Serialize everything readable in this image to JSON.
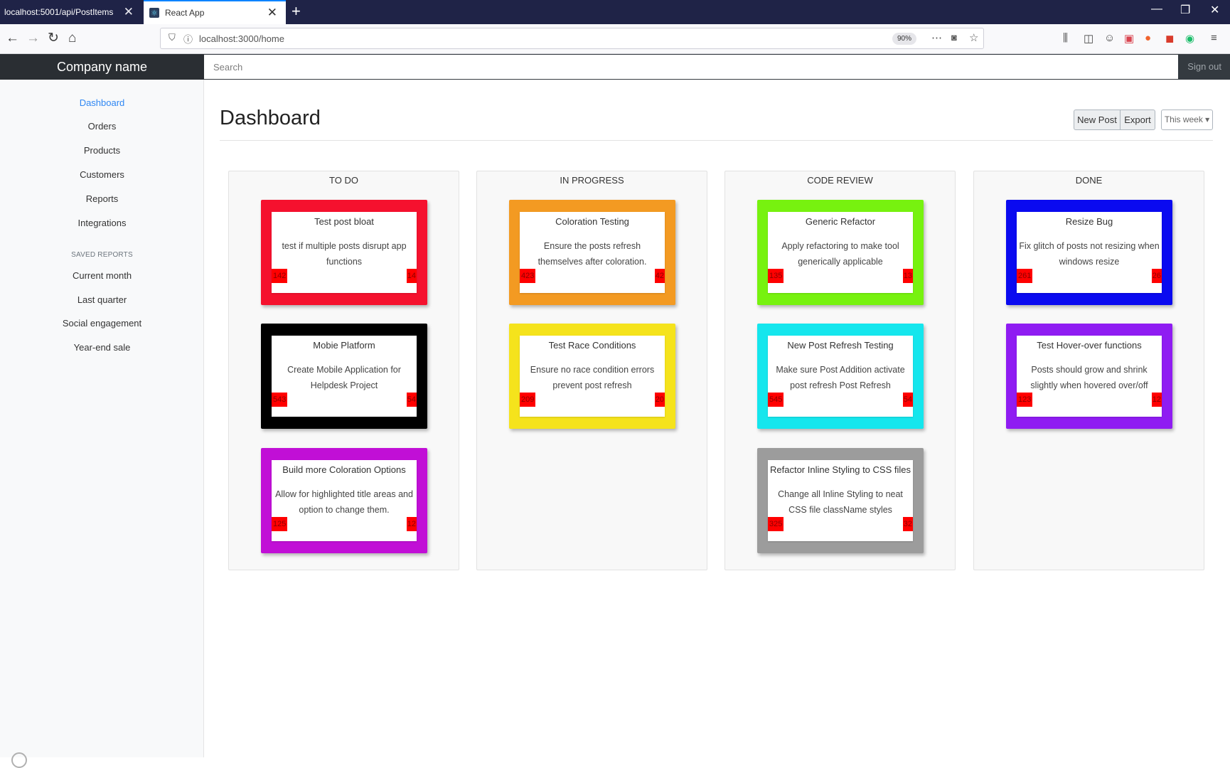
{
  "browser": {
    "tabs": [
      {
        "title": "localhost:5001/api/PostItems",
        "active": false
      },
      {
        "title": "React App",
        "active": true
      }
    ],
    "url": "localhost:3000/home",
    "zoom": "90%"
  },
  "app": {
    "brand": "Company name",
    "search_placeholder": "Search",
    "sign_out": "Sign out"
  },
  "sidebar": {
    "items": [
      {
        "label": "Dashboard",
        "active": true
      },
      {
        "label": "Orders"
      },
      {
        "label": "Products"
      },
      {
        "label": "Customers"
      },
      {
        "label": "Reports"
      },
      {
        "label": "Integrations"
      }
    ],
    "saved_heading": "SAVED REPORTS",
    "saved": [
      {
        "label": "Current month"
      },
      {
        "label": "Last quarter"
      },
      {
        "label": "Social engagement"
      },
      {
        "label": "Year-end sale"
      }
    ]
  },
  "main": {
    "title": "Dashboard",
    "buttons": {
      "new_post": "New Post",
      "export": "Export",
      "this_week": "This week ▾"
    }
  },
  "board": {
    "columns": [
      {
        "title": "TO DO",
        "cards": [
          {
            "title": "Test post bloat",
            "desc": "test if multiple posts disrupt app functions",
            "color": "#f5112e",
            "left": "142",
            "right": "14"
          },
          {
            "title": "Mobie Platform",
            "desc": "Create Mobile Application for Helpdesk Project",
            "color": "#000000",
            "left": "543",
            "right": "54"
          },
          {
            "title": "Build more Coloration Options",
            "desc": "Allow for highlighted title areas and option to change them.",
            "color": "#c10fd6",
            "left": "125",
            "right": "12"
          }
        ]
      },
      {
        "title": "IN PROGRESS",
        "cards": [
          {
            "title": "Coloration Testing",
            "desc": "Ensure the posts refresh themselves after coloration.",
            "color": "#f39a22",
            "left": "423",
            "right": "42"
          },
          {
            "title": "Test Race Conditions",
            "desc": "Ensure no race condition errors prevent post refresh",
            "color": "#f5e31c",
            "left": "209",
            "right": "20"
          }
        ]
      },
      {
        "title": "CODE REVIEW",
        "cards": [
          {
            "title": "Generic Refactor",
            "desc": "Apply refactoring to make tool generically applicable",
            "color": "#77f20f",
            "left": "135",
            "right": "13"
          },
          {
            "title": "New Post Refresh Testing",
            "desc": "Make sure Post Addition activate post refresh Post Refresh",
            "color": "#15e6ed",
            "left": "545",
            "right": "54"
          },
          {
            "title": "Refactor Inline Styling to CSS files",
            "desc": "Change all Inline Styling to neat CSS file className styles",
            "color": "#9c9c9c",
            "left": "325",
            "right": "32"
          }
        ]
      },
      {
        "title": "DONE",
        "cards": [
          {
            "title": "Resize Bug",
            "desc": "Fix glitch of posts not resizing when windows resize",
            "color": "#0a0af0",
            "left": "261",
            "right": "26"
          },
          {
            "title": "Test Hover-over functions",
            "desc": "Posts should grow and shrink slightly when hovered over/off",
            "color": "#8f1cf2",
            "left": "123",
            "right": "12"
          }
        ]
      }
    ]
  }
}
